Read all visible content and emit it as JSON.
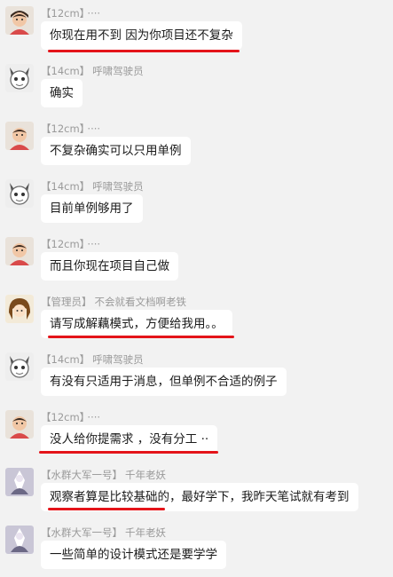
{
  "messages": [
    {
      "tag": "【12cm】",
      "name": "····",
      "avatar": "child-avatar",
      "text": "你现在用不到 因为你项目还不复杂"
    },
    {
      "tag": "【14cm】",
      "name": "呼啸驾驶员",
      "avatar": "cartoon-avatar",
      "text": "确实"
    },
    {
      "tag": "【12cm】",
      "name": "····",
      "avatar": "child-avatar",
      "text": "不复杂确实可以只用单例"
    },
    {
      "tag": "【14cm】",
      "name": "呼啸驾驶员",
      "avatar": "cartoon-avatar",
      "text": "目前单例够用了"
    },
    {
      "tag": "【12cm】",
      "name": "····",
      "avatar": "child-avatar",
      "text": "而且你现在项目自己做"
    },
    {
      "tag": "【管理员】",
      "name": "不会就看文档啊老铁",
      "avatar": "anime-avatar",
      "text": "请写成解藕模式，方便给我用。。"
    },
    {
      "tag": "【14cm】",
      "name": "呼啸驾驶员",
      "avatar": "cartoon-avatar",
      "text": "有没有只适用于消息，但单例不合适的例子"
    },
    {
      "tag": "【12cm】",
      "name": "····",
      "avatar": "child-avatar",
      "text": "没人给你提需求 ，没有分工 ··"
    },
    {
      "tag": "【水群大军一号】",
      "name": "千年老妖",
      "avatar": "fantasy-avatar",
      "text": "观察者算是比较基础的，最好学下，我昨天笔试就有考到"
    },
    {
      "tag": "【水群大军一号】",
      "name": "千年老妖",
      "avatar": "fantasy-avatar",
      "text": "一些简单的设计模式还是要学学"
    }
  ],
  "colors": {
    "background": "#f2f2f2",
    "bubble": "#ffffff",
    "meta": "#9a9a9a",
    "underline": "#e4141a"
  }
}
